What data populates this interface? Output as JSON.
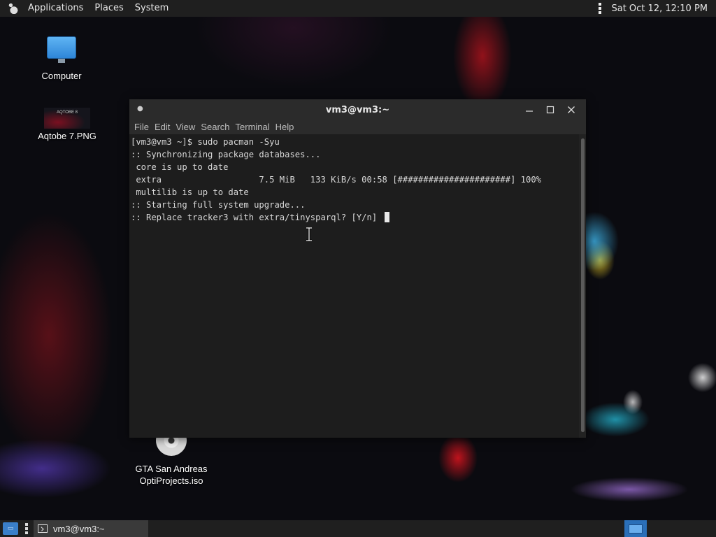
{
  "top_panel": {
    "menu": [
      "Applications",
      "Places",
      "System"
    ],
    "clock": "Sat Oct 12, 12:10 PM"
  },
  "desktop": {
    "icons": [
      {
        "label": "Computer",
        "icon": "monitor-icon"
      },
      {
        "label": "Aqtobe 7.PNG",
        "icon": "image-thumbnail-icon",
        "thumb_text": "AQTOBE 8"
      },
      {
        "label_lines": [
          "GTA San Andreas",
          "OptiProjects.iso"
        ],
        "icon": "disc-icon"
      }
    ]
  },
  "terminal": {
    "title": "vm3@vm3:~",
    "menu": [
      "File",
      "Edit",
      "View",
      "Search",
      "Terminal",
      "Help"
    ],
    "lines": [
      "[vm3@vm3 ~]$ sudo pacman -Syu",
      ":: Synchronizing package databases...",
      " core is up to date",
      " extra                   7.5 MiB   133 KiB/s 00:58 [######################] 100%",
      " multilib is up to date",
      ":: Starting full system upgrade...",
      ":: Replace tracker3 with extra/tinysparql? [Y/n] "
    ]
  },
  "taskbar": {
    "window_button": "vm3@vm3:~"
  },
  "colors": {
    "panel": "#1f1f1f",
    "terminal_bg": "#1d1d1d",
    "accent": "#2a6fb8"
  }
}
